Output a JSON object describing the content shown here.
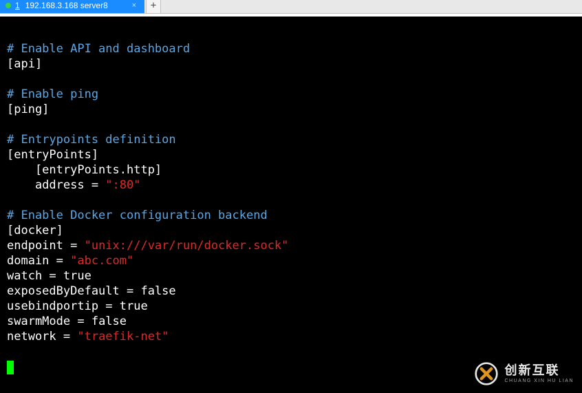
{
  "tab": {
    "index": "1",
    "title": "192.168.3.168 server8",
    "close": "×"
  },
  "new_tab": "+",
  "code": {
    "l1": "# Enable API and dashboard",
    "l2": "[api]",
    "l3": "",
    "l4": "# Enable ping",
    "l5": "[ping]",
    "l6": "",
    "l7": "# Entrypoints definition",
    "l8": "[entryPoints]",
    "l9": "    [entryPoints.http]",
    "l10k": "    address = ",
    "l10v": "\":80\"",
    "l11": "",
    "l12": "# Enable Docker configuration backend",
    "l13": "[docker]",
    "l14k": "endpoint = ",
    "l14v": "\"unix:///var/run/docker.sock\"",
    "l15k": "domain = ",
    "l15v": "\"abc.com\"",
    "l16k": "watch = ",
    "l16v": "true",
    "l17k": "exposedByDefault = ",
    "l17v": "false",
    "l18k": "usebindportip = ",
    "l18v": "true",
    "l19k": "swarmMode = ",
    "l19v": "false",
    "l20k": "network = ",
    "l20v": "\"traefik-net\""
  },
  "watermark": {
    "cn": "创新互联",
    "en": "CHUANG XIN HU LIAN"
  }
}
